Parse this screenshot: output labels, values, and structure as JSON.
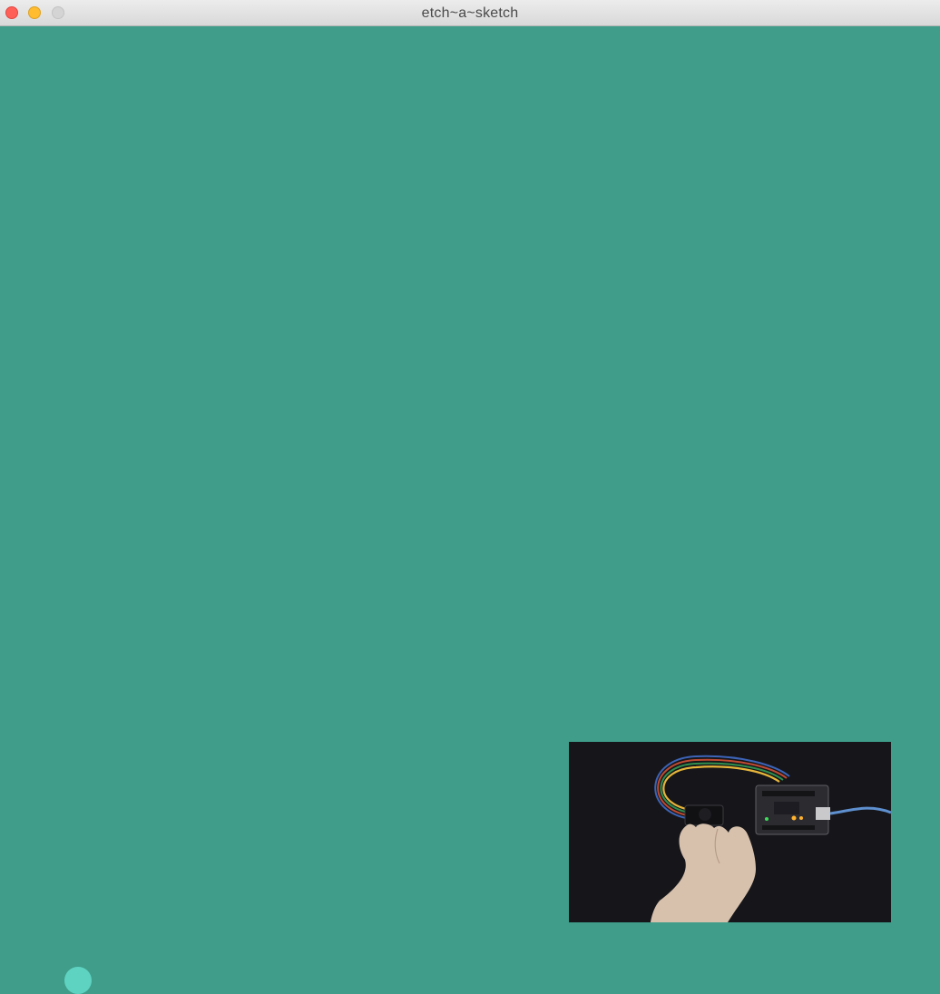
{
  "window": {
    "title": "etch~a~sketch",
    "traffic_lights": [
      "close-button",
      "minimize-button",
      "maximize-button"
    ]
  },
  "canvas": {
    "background_color": "#3f9d8a",
    "cursor_color": "#5fd3c2"
  },
  "video_overlay": {
    "description_icon": "arduino-board-with-joystick-photo"
  }
}
